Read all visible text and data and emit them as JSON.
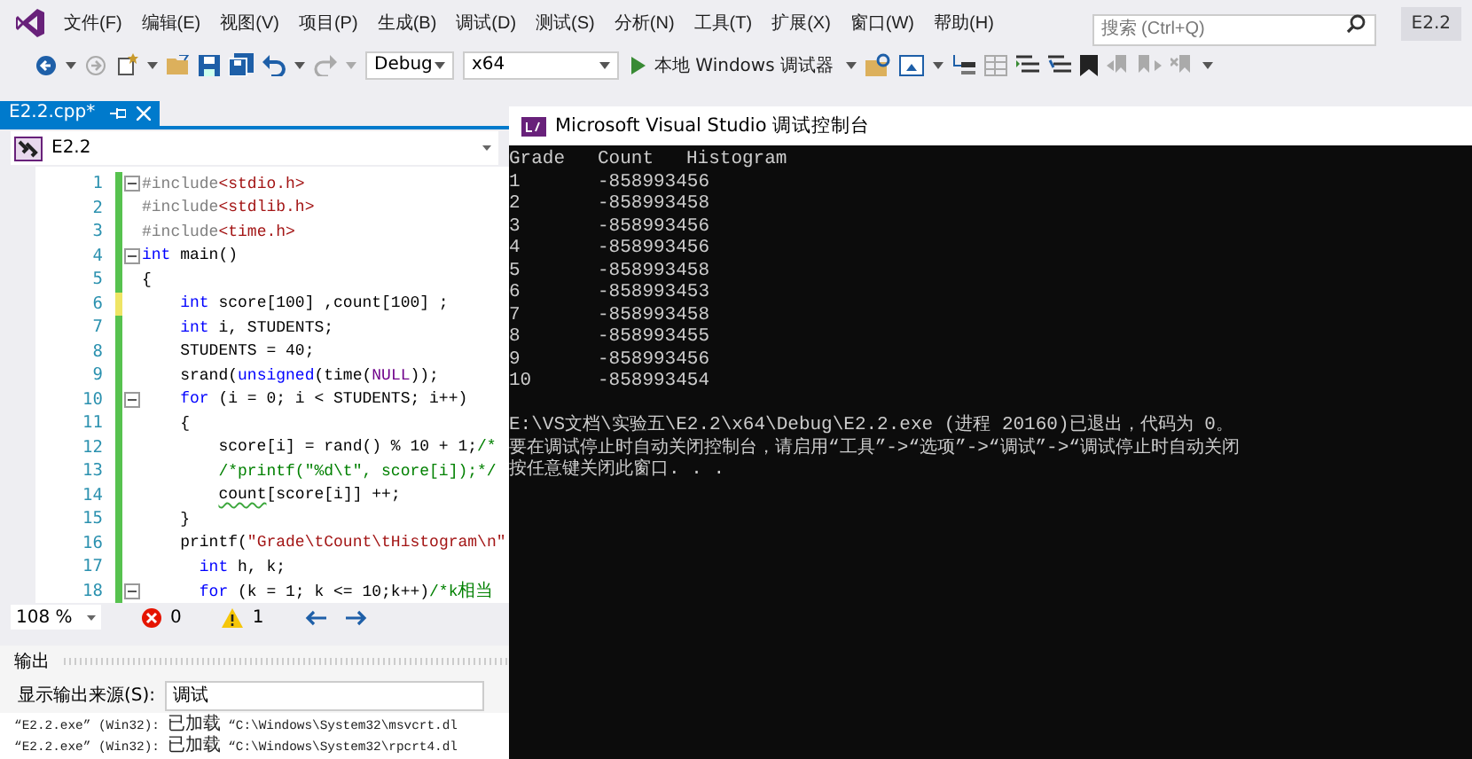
{
  "menu_bar": {
    "items": [
      "文件(F)",
      "编辑(E)",
      "视图(V)",
      "项目(P)",
      "生成(B)",
      "调试(D)",
      "测试(S)",
      "分析(N)",
      "工具(T)",
      "扩展(X)",
      "窗口(W)",
      "帮助(H)"
    ],
    "search": {
      "placeholder": "搜索 (Ctrl+Q)"
    },
    "project_badge": "E2.2"
  },
  "toolbar": {
    "configuration": "Debug",
    "platform": "x64",
    "start_label": "本地 Windows 调试器"
  },
  "editor": {
    "tab": {
      "label": "E2.2.cpp*"
    },
    "scope": "E2.2",
    "lines": [
      {
        "number": "1",
        "modified": false,
        "fold": true,
        "segments": [
          {
            "kind": "pp",
            "text": "#include"
          },
          {
            "kind": "str",
            "text": "<stdio.h>"
          }
        ]
      },
      {
        "number": "2",
        "modified": false,
        "fold": false,
        "segments": [
          {
            "kind": "pp",
            "text": "#include"
          },
          {
            "kind": "str",
            "text": "<stdlib.h>"
          }
        ]
      },
      {
        "number": "3",
        "modified": false,
        "fold": false,
        "segments": [
          {
            "kind": "pp",
            "text": "#include"
          },
          {
            "kind": "str",
            "text": "<time.h>"
          }
        ]
      },
      {
        "number": "4",
        "modified": false,
        "fold": true,
        "segments": [
          {
            "kind": "kw",
            "text": "int"
          },
          {
            "kind": "plain",
            "text": " main()"
          }
        ]
      },
      {
        "number": "5",
        "modified": false,
        "fold": false,
        "segments": [
          {
            "kind": "plain",
            "text": "{"
          }
        ]
      },
      {
        "number": "6",
        "modified": true,
        "fold": false,
        "segments": [
          {
            "kind": "kw",
            "text": "    int"
          },
          {
            "kind": "plain",
            "text": " score[100] ,count[100] ;"
          }
        ]
      },
      {
        "number": "7",
        "modified": false,
        "fold": false,
        "segments": [
          {
            "kind": "kw",
            "text": "    int"
          },
          {
            "kind": "plain",
            "text": " i, STUDENTS;"
          }
        ]
      },
      {
        "number": "8",
        "modified": false,
        "fold": false,
        "segments": [
          {
            "kind": "plain",
            "text": "    STUDENTS = 40;"
          }
        ]
      },
      {
        "number": "9",
        "modified": false,
        "fold": false,
        "segments": [
          {
            "kind": "plain",
            "text": "    srand("
          },
          {
            "kind": "kw",
            "text": "unsigned"
          },
          {
            "kind": "plain",
            "text": "(time("
          },
          {
            "kind": "macro",
            "text": "NULL"
          },
          {
            "kind": "plain",
            "text": "));"
          }
        ]
      },
      {
        "number": "10",
        "modified": false,
        "fold": true,
        "segments": [
          {
            "kind": "kw",
            "text": "    for"
          },
          {
            "kind": "plain",
            "text": " (i = 0; i < STUDENTS; i++)"
          }
        ]
      },
      {
        "number": "11",
        "modified": false,
        "fold": false,
        "segments": [
          {
            "kind": "plain",
            "text": "    {"
          }
        ]
      },
      {
        "number": "12",
        "modified": false,
        "fold": false,
        "segments": [
          {
            "kind": "plain",
            "text": "        score[i] = rand() % 10 + 1;"
          },
          {
            "kind": "cm",
            "text": "/*"
          }
        ]
      },
      {
        "number": "13",
        "modified": false,
        "fold": false,
        "segments": [
          {
            "kind": "cm",
            "text": "        /*printf(\"%d\\t\", score[i]);*/"
          }
        ]
      },
      {
        "number": "14",
        "modified": false,
        "fold": false,
        "segments": [
          {
            "kind": "squiggle",
            "text": "        count"
          },
          {
            "kind": "plain",
            "text": "[score[i]] ++;"
          }
        ]
      },
      {
        "number": "15",
        "modified": false,
        "fold": false,
        "segments": [
          {
            "kind": "plain",
            "text": "    }"
          }
        ]
      },
      {
        "number": "16",
        "modified": false,
        "fold": false,
        "segments": [
          {
            "kind": "plain",
            "text": "    printf("
          },
          {
            "kind": "str",
            "text": "\"Grade\\tCount\\tHistogram\\n\""
          }
        ]
      },
      {
        "number": "17",
        "modified": false,
        "fold": false,
        "segments": [
          {
            "kind": "kw",
            "text": "      int"
          },
          {
            "kind": "plain",
            "text": " h, k;"
          }
        ]
      },
      {
        "number": "18",
        "modified": false,
        "fold": true,
        "segments": [
          {
            "kind": "kw",
            "text": "      for"
          },
          {
            "kind": "plain",
            "text": " (k = 1; k <= 10;k++)"
          },
          {
            "kind": "cm",
            "text": "/*k相当"
          }
        ]
      }
    ],
    "status": {
      "zoom": "108 %",
      "errors": "0",
      "warnings": "1"
    }
  },
  "output": {
    "title": "输出",
    "source_label": "显示输出来源(S):",
    "source": "调试",
    "lines": [
      "“E2.2.exe” (Win32): 已加载 “C:\\Windows\\System32\\msvcrt.dl",
      "“E2.2.exe” (Win32): 已加载 “C:\\Windows\\System32\\rpcrt4.dl"
    ]
  },
  "console": {
    "title": "Microsoft Visual Studio 调试控制台",
    "header": [
      "Grade",
      "Count",
      "Histogram"
    ],
    "rows": [
      {
        "grade": "1",
        "count": "-858993456"
      },
      {
        "grade": "2",
        "count": "-858993458"
      },
      {
        "grade": "3",
        "count": "-858993456"
      },
      {
        "grade": "4",
        "count": "-858993456"
      },
      {
        "grade": "5",
        "count": "-858993458"
      },
      {
        "grade": "6",
        "count": "-858993453"
      },
      {
        "grade": "7",
        "count": "-858993458"
      },
      {
        "grade": "8",
        "count": "-858993455"
      },
      {
        "grade": "9",
        "count": "-858993456"
      },
      {
        "grade": "10",
        "count": "-858993454"
      }
    ],
    "messages": [
      "E:\\VS文档\\实验五\\E2.2\\x64\\Debug\\E2.2.exe (进程 20160)已退出，代码为 0。",
      "要在调试停止时自动关闭控制台，请启用“工具”->“选项”->“调试”->“调试停止时自动关闭",
      "按任意键关闭此窗口. . ."
    ]
  }
}
